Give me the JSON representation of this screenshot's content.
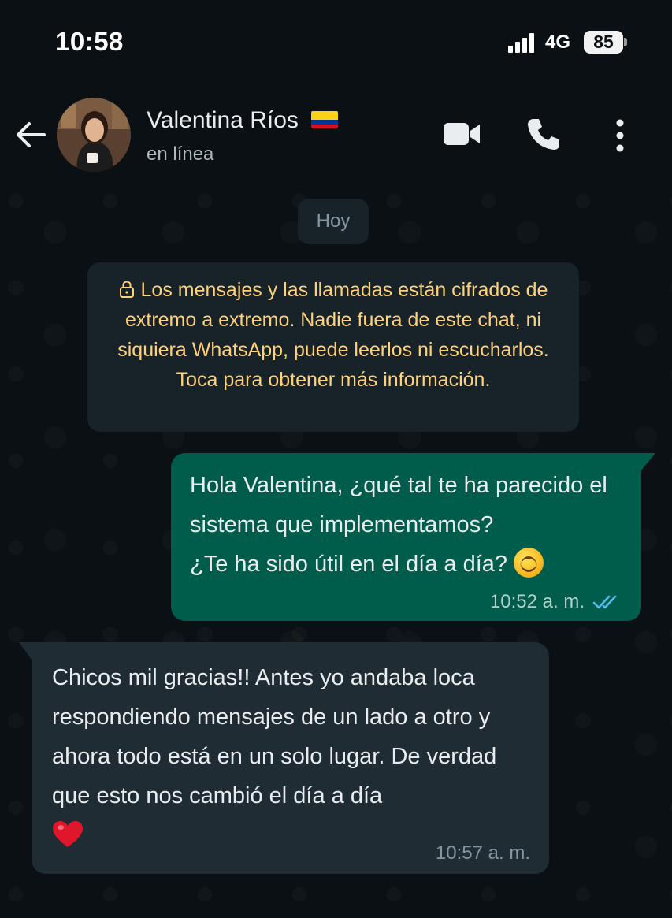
{
  "status_bar": {
    "time": "10:58",
    "network": "4G",
    "battery": "85"
  },
  "header": {
    "contact_name": "Valentina Ríos",
    "status": "en línea",
    "icons": [
      "back-arrow-icon",
      "video-call-icon",
      "phone-icon",
      "more-vert-icon"
    ]
  },
  "chat": {
    "date_chip": "Hoy",
    "encryption_notice": "Los mensajes y las llamadas están cifrados de extremo a extremo. Nadie fuera de este chat, ni siquiera WhatsApp, puede leerlos ni escucharlos. Toca para obtener más información.",
    "messages": [
      {
        "direction": "outgoing",
        "text": "Hola Valentina, ¿qué tal te ha parecido el sistema que implementamos?\n¿Te ha sido útil en el día a día? ",
        "emoji": "smiling-face",
        "time": "10:52 a. m.",
        "status": "read"
      },
      {
        "direction": "incoming",
        "text": "Chicos mil gracias!! Antes yo andaba loca respondiendo mensajes de un lado a otro y ahora todo está en un solo lugar. De verdad que esto nos cambió el día a día",
        "emoji": "red-heart",
        "time": "10:57 a. m."
      }
    ]
  },
  "colors": {
    "background": "#0b1014",
    "outgoing_bubble": "#005c4b",
    "incoming_bubble": "#1f2c34",
    "notice_text": "#ffd279",
    "read_ticks": "#53bdeb"
  }
}
